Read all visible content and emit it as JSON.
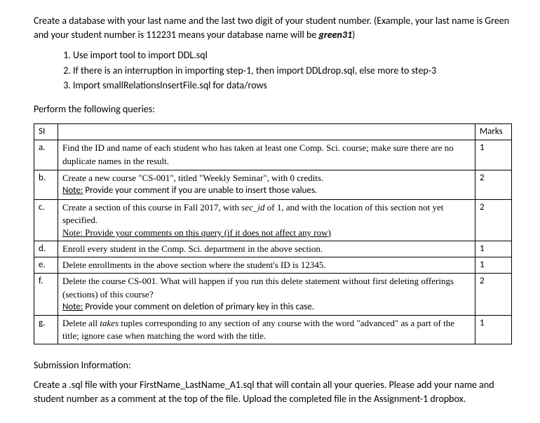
{
  "intro": {
    "line1a": "Create a database with your last name and the last two digit of your student number. (Example, your",
    "line2a": "last name is Green and your student number is 112231 means your database name will be ",
    "example": "green31",
    "line2b": ")"
  },
  "steps": [
    "Use import tool to import DDL.sql",
    "If there is an interruption in importing step-1, then import DDLdrop.sql, else more to step-3",
    "Import smallRelationsInsertFile.sql for data/rows"
  ],
  "perform": "Perform the following queries:",
  "headers": {
    "si": "SI",
    "marks": "Marks"
  },
  "rows": {
    "a": {
      "si": "a.",
      "text1": "Find the ID and name of each student who has taken at least one Comp. Sci. course; make sure there are no duplicate names in the result.",
      "marks": "1"
    },
    "b": {
      "si": "b.",
      "text1": "Create a new course \"CS-001\", titled \"Weekly Seminar\", with 0 credits.",
      "noteLabel": "Note:",
      "noteText": " Provide your comment if you are unable to insert those values.",
      "marks": "2"
    },
    "c": {
      "si": "c.",
      "text1a": "Create a section of this course in Fall 2017, with ",
      "secId": "sec_id",
      "text1b": " of 1, and with the location of this section not yet specified.",
      "noteFull": "Note: Provide your comments on this query (if it does not affect any row)",
      "marks": "2"
    },
    "d": {
      "si": "d.",
      "text1": "Enroll every student in the Comp. Sci. department in the above section.",
      "marks": "1"
    },
    "e": {
      "si": "e.",
      "text1": "Delete enrollments in the above section where the student's ID is 12345.",
      "marks": "1"
    },
    "f": {
      "si": "f.",
      "text1": "Delete the course CS-001. What will happen if you run this delete statement without first deleting offerings (sections) of this course?",
      "noteLabel": "Note:",
      "noteText": " Provide your comment on deletion of primary key in this case.",
      "marks": "2"
    },
    "g": {
      "si": "g.",
      "text1a": "Delete all ",
      "takes": "takes",
      "text1b": " tuples corresponding to any section of any course with the word \"advanced\" as a part of the title; ignore case when matching the word with the title.",
      "marks": "1"
    }
  },
  "submission": {
    "heading": "Submission Information:",
    "body": "Create a .sql file with your FirstName_LastName_A1.sql that will contain all your queries.  Please add your name and student number as a comment at the top of the file. Upload the completed file in the Assignment-1 dropbox."
  }
}
